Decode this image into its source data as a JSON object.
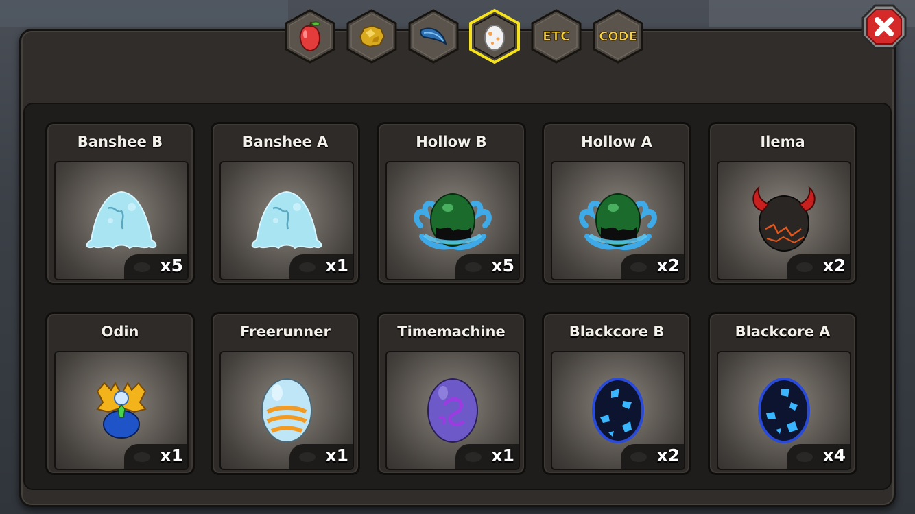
{
  "tabs": [
    {
      "name": "fruit-tab",
      "icon": "red-fruit-icon",
      "label": "",
      "active": false
    },
    {
      "name": "ore-tab",
      "icon": "gold-ore-icon",
      "label": "",
      "active": false
    },
    {
      "name": "feather-tab",
      "icon": "blue-feather-icon",
      "label": "",
      "active": false
    },
    {
      "name": "egg-tab",
      "icon": "egg-icon",
      "label": "",
      "active": true
    },
    {
      "name": "etc-tab",
      "icon": "",
      "label": "ETC",
      "active": false
    },
    {
      "name": "code-tab",
      "icon": "",
      "label": "CODE",
      "active": false
    }
  ],
  "close_button": {
    "icon": "close-x-icon",
    "color": "#d62a2a"
  },
  "colors": {
    "tab_active_border": "#f5e21c",
    "tab_text": "#f6d23c",
    "panel_bg": "#302d2a"
  },
  "items": [
    {
      "name": "Banshee B",
      "count": "x5",
      "egg": "banshee"
    },
    {
      "name": "Banshee A",
      "count": "x1",
      "egg": "banshee"
    },
    {
      "name": "Hollow B",
      "count": "x5",
      "egg": "hollow"
    },
    {
      "name": "Hollow A",
      "count": "x2",
      "egg": "hollow"
    },
    {
      "name": "Ilema",
      "count": "x2",
      "egg": "ilema"
    },
    {
      "name": "Odin",
      "count": "x1",
      "egg": "odin"
    },
    {
      "name": "Freerunner",
      "count": "x1",
      "egg": "freerunner"
    },
    {
      "name": "Timemachine",
      "count": "x1",
      "egg": "timemachine"
    },
    {
      "name": "Blackcore B",
      "count": "x2",
      "egg": "blackcore"
    },
    {
      "name": "Blackcore A",
      "count": "x4",
      "egg": "blackcore"
    }
  ]
}
